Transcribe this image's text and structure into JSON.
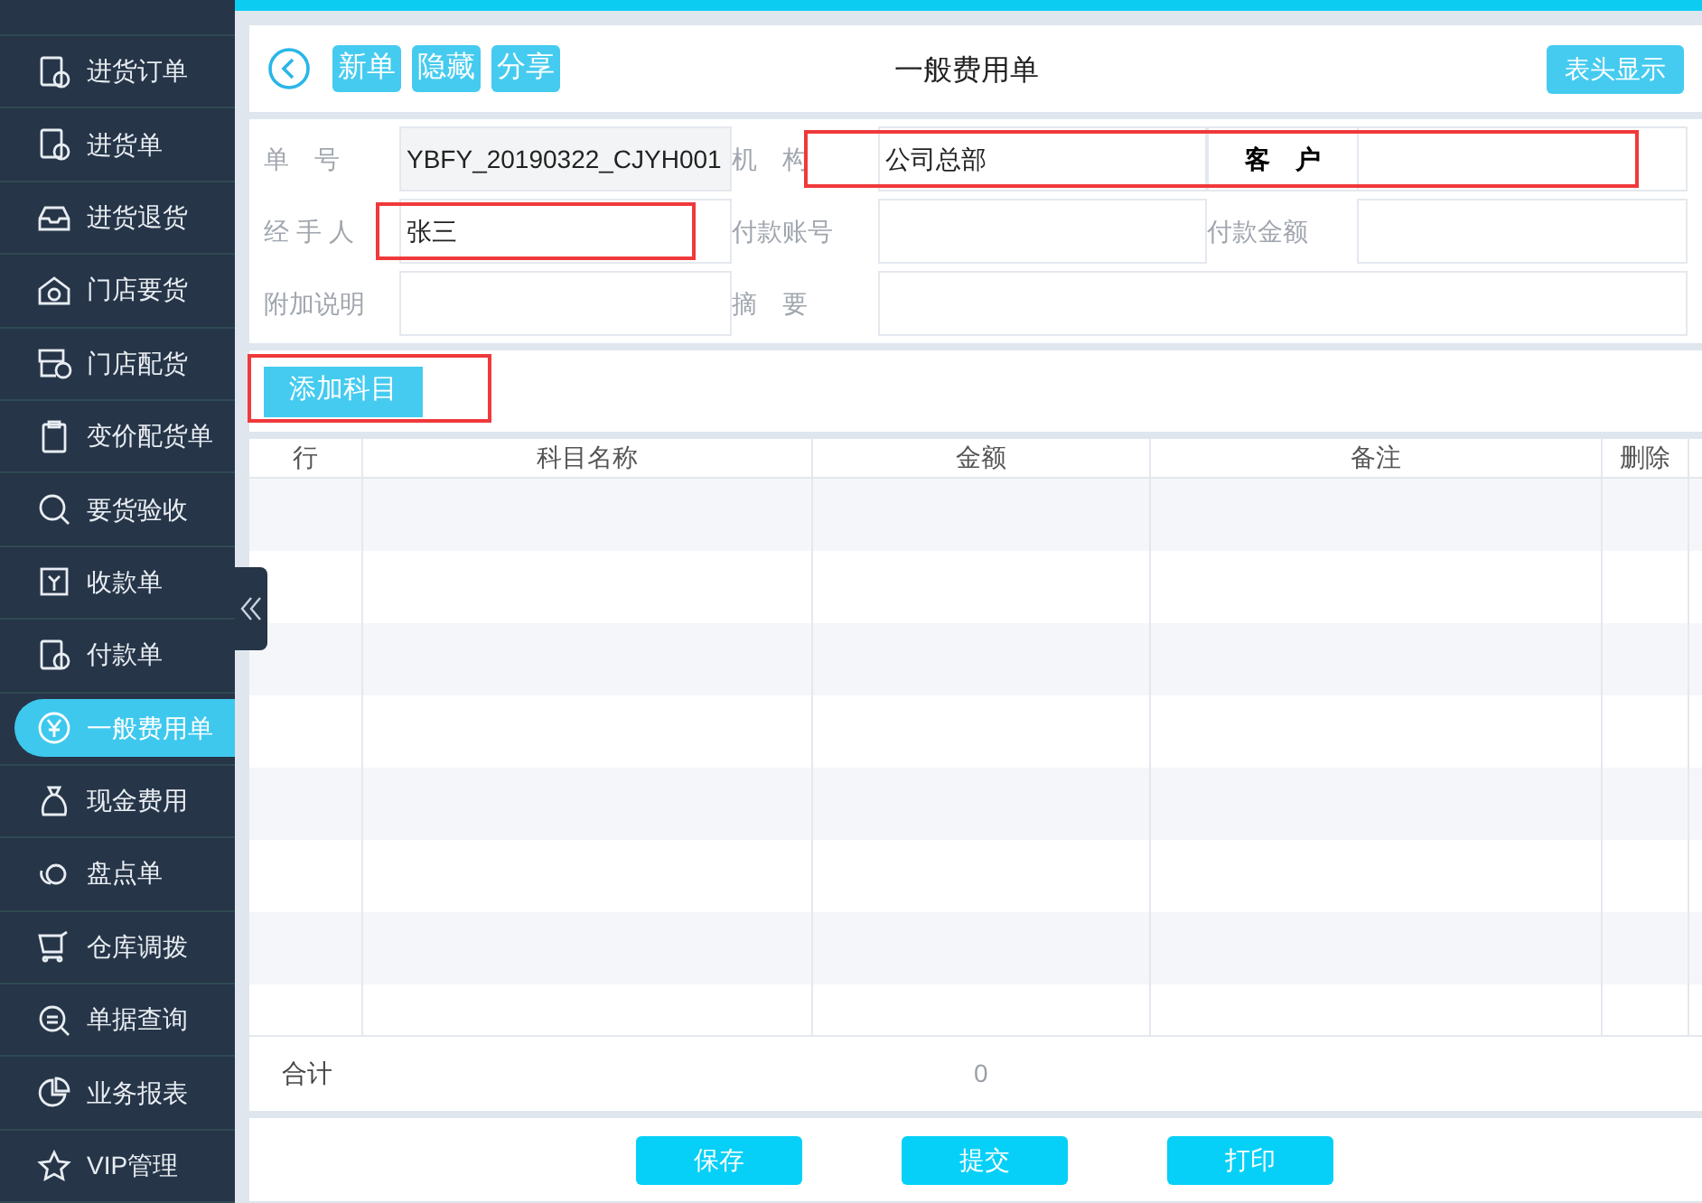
{
  "sidebar": {
    "items": [
      {
        "label": "进货订单",
        "selected": false
      },
      {
        "label": "进货单",
        "selected": false
      },
      {
        "label": "进货退货",
        "selected": false
      },
      {
        "label": "门店要货",
        "selected": false
      },
      {
        "label": "门店配货",
        "selected": false
      },
      {
        "label": "变价配货单",
        "selected": false
      },
      {
        "label": "要货验收",
        "selected": false
      },
      {
        "label": "收款单",
        "selected": false
      },
      {
        "label": "付款单",
        "selected": false
      },
      {
        "label": "一般费用单",
        "selected": true
      },
      {
        "label": "现金费用",
        "selected": false
      },
      {
        "label": "盘点单",
        "selected": false
      },
      {
        "label": "仓库调拨",
        "selected": false
      },
      {
        "label": "单据查询",
        "selected": false
      },
      {
        "label": "业务报表",
        "selected": false
      },
      {
        "label": "VIP管理",
        "selected": false
      }
    ]
  },
  "toolbar": {
    "buttons": [
      "新单",
      "隐藏",
      "分享"
    ],
    "title": "一般费用单",
    "right_button": "表头显示"
  },
  "form": {
    "rows": [
      [
        {
          "label": "单　号",
          "value": "YBFY_20190322_CJYH001",
          "readonly": true,
          "highlighted": false
        },
        {
          "label": "机　构",
          "value": "公司总部",
          "readonly": false,
          "highlighted": true
        },
        {
          "label": "客　户",
          "readonly": false,
          "highlighted": true,
          "bold": true
        }
      ],
      [
        {
          "label": "经 手 人",
          "value": "张三",
          "readonly": false,
          "highlighted": true
        },
        {
          "label": "付款账号",
          "readonly": false,
          "highlighted": false
        },
        {
          "label": "付款金额",
          "readonly": false,
          "highlighted": false
        }
      ],
      [
        {
          "label": "附加说明",
          "readonly": false,
          "highlighted": false
        },
        {
          "label": "摘　要",
          "readonly": false,
          "highlighted": false,
          "wide": true
        }
      ]
    ]
  },
  "add_button": {
    "label": "添加科目",
    "highlighted": true
  },
  "table": {
    "columns": [
      "行",
      "科目名称",
      "金额",
      "备注",
      "删除"
    ]
  },
  "summary": {
    "label": "合计",
    "total": "0"
  },
  "footer": {
    "buttons": [
      "保存",
      "提交",
      "打印"
    ]
  }
}
